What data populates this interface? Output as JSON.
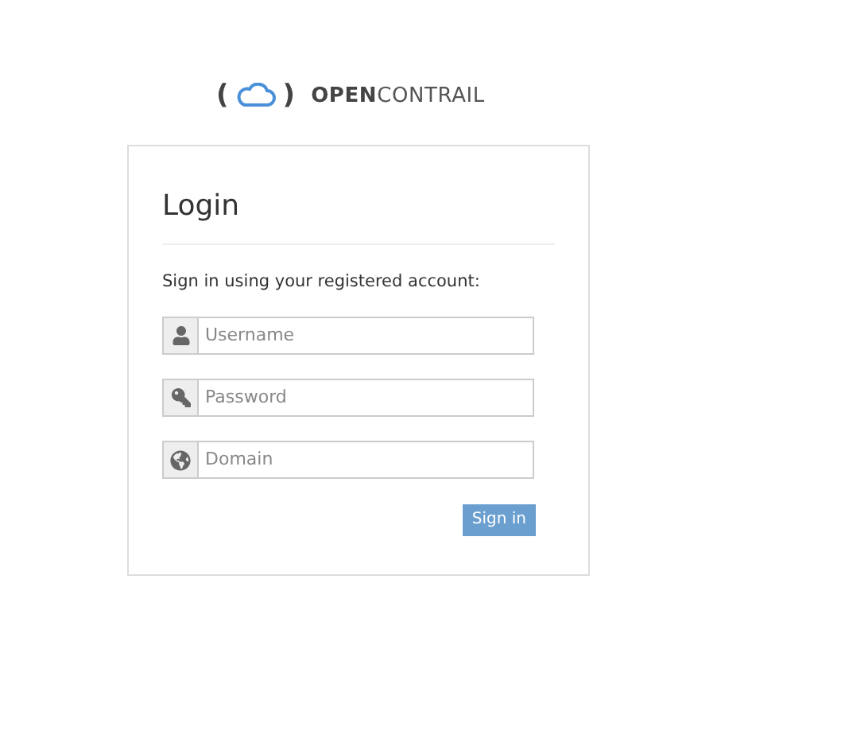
{
  "logo": {
    "left_paren": "(",
    "right_paren": ")",
    "bold_part": "OPEN",
    "regular_part": "CONTRAIL"
  },
  "card": {
    "title": "Login",
    "subtitle": "Sign in using your registered account:",
    "fields": [
      {
        "kind": "user",
        "placeholder": "Username"
      },
      {
        "kind": "key",
        "placeholder": "Password"
      },
      {
        "kind": "globe",
        "placeholder": "Domain"
      }
    ],
    "button": "Sign in"
  }
}
